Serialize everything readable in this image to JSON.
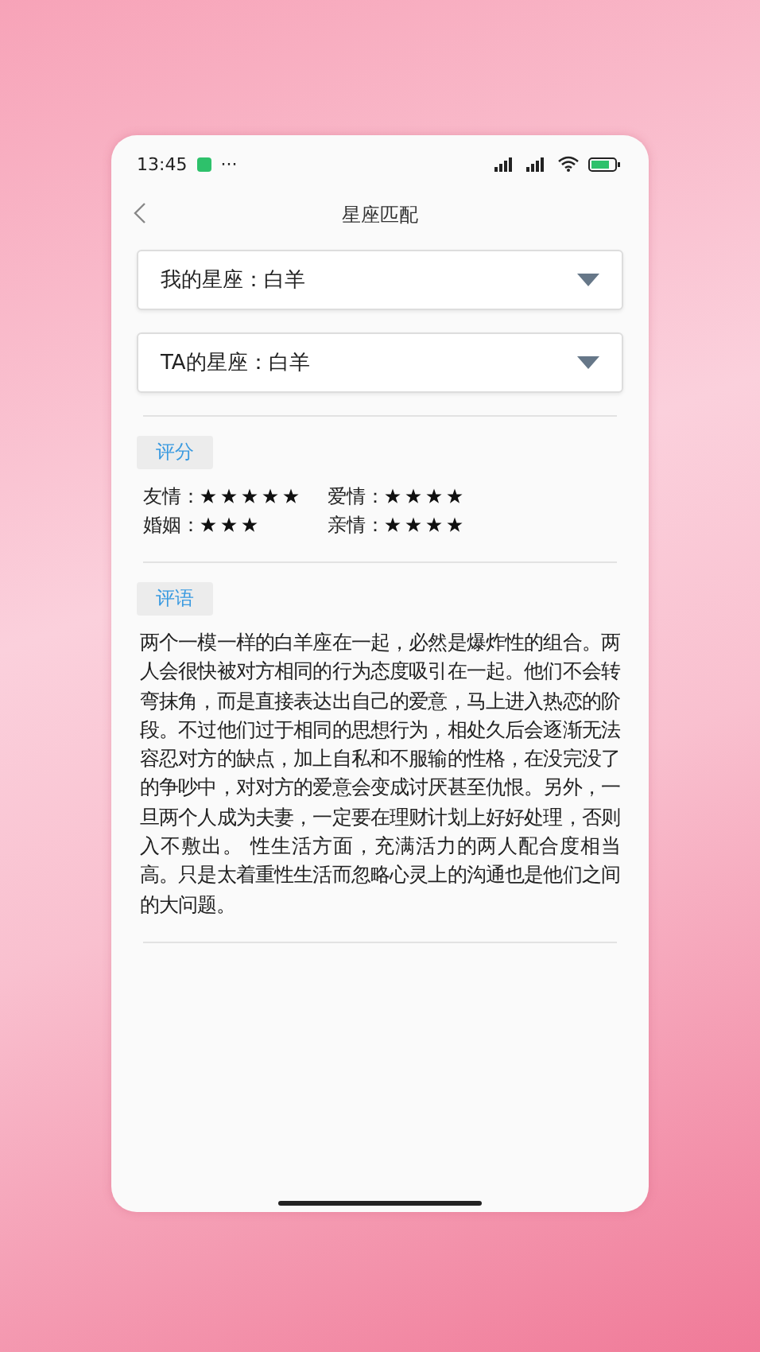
{
  "status_bar": {
    "time": "13:45",
    "more": "···"
  },
  "header": {
    "title": "星座匹配"
  },
  "selectors": [
    {
      "label": "我的星座：白羊"
    },
    {
      "label": "TA的星座：白羊"
    }
  ],
  "score_section": {
    "heading": "评分",
    "ratings": [
      {
        "label": "友情：",
        "stars": 5
      },
      {
        "label": "爱情：",
        "stars": 4
      },
      {
        "label": "婚姻：",
        "stars": 3
      },
      {
        "label": "亲情：",
        "stars": 4
      }
    ]
  },
  "comment_section": {
    "heading": "评语",
    "text": "两个一模一样的白羊座在一起，必然是爆炸性的组合。两人会很快被对方相同的行为态度吸引在一起。他们不会转弯抹角，而是直接表达出自己的爱意，马上进入热恋的阶段。不过他们过于相同的思想行为，相处久后会逐渐无法容忍对方的缺点，加上自私和不服输的性格，在没完没了的争吵中，对对方的爱意会变成讨厌甚至仇恨。另外，一旦两个人成为夫妻，一定要在理财计划上好好处理，否则入不敷出。 性生活方面，充满活力的两人配合度相当高。只是太着重性生活而忽略心灵上的沟通也是他们之间的大问题。"
  }
}
